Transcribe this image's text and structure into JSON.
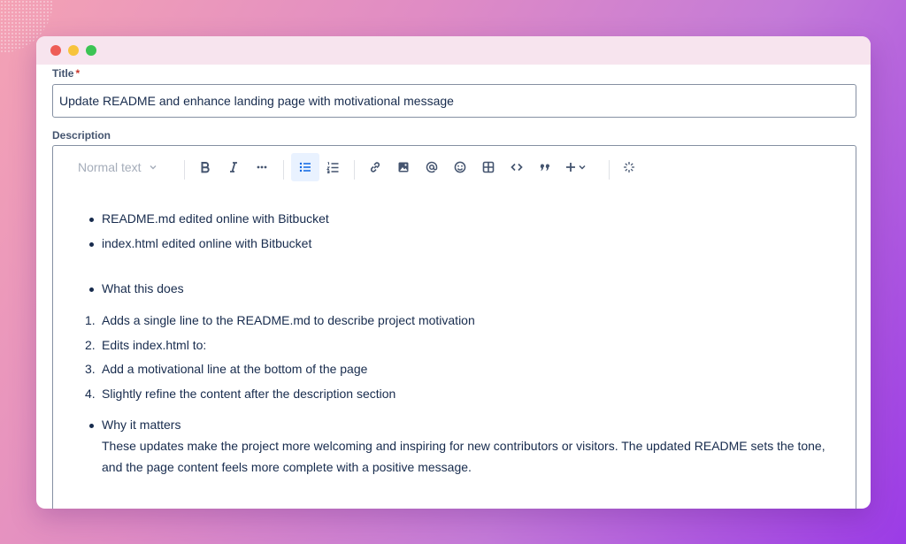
{
  "form": {
    "title_label": "Title",
    "required_mark": "*",
    "title_value": "Update README and enhance landing page with motivational message",
    "description_label": "Description"
  },
  "toolbar": {
    "text_style": "Normal text",
    "icons": [
      "bold-icon",
      "italic-icon",
      "more-icon",
      "bullet-list-icon",
      "numbered-list-icon",
      "link-icon",
      "image-icon",
      "mention-icon",
      "emoji-icon",
      "table-icon",
      "code-icon",
      "quote-icon",
      "insert-icon",
      "ai-icon"
    ],
    "active": "bullet-list-icon"
  },
  "content": {
    "bullets_top": [
      "README.md edited online with Bitbucket",
      "index.html edited online with Bitbucket"
    ],
    "what_heading": "What this does",
    "numbered": [
      "Adds a single line to the README.md to describe project motivation",
      "Edits index.html to:",
      "Add a motivational line at the bottom of the page",
      "Slightly refine the content after the description section"
    ],
    "why_heading": "Why it matters",
    "why_text": "These updates make the project more welcoming and inspiring for new contributors or visitors. The updated README sets the tone, and the page content feels more complete with a positive message."
  },
  "colors": {
    "accent": "#0c66e4",
    "text": "#172b4d",
    "label": "#44546f",
    "required": "#c9372c"
  }
}
